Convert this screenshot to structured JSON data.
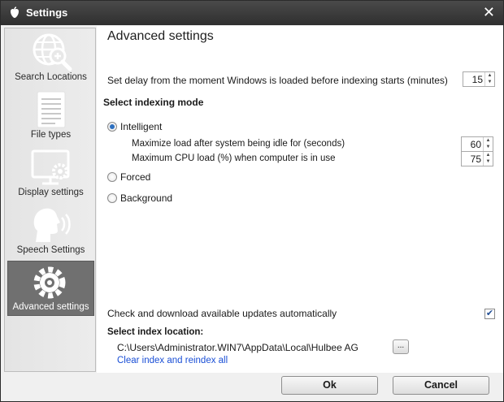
{
  "window": {
    "title": "Settings",
    "close_glyph": "✕"
  },
  "sidebar": {
    "items": [
      {
        "label": "Search Locations",
        "icon": "globe-search-icon"
      },
      {
        "label": "File types",
        "icon": "document-icon"
      },
      {
        "label": "Display settings",
        "icon": "display-gear-icon"
      },
      {
        "label": "Speech Settings",
        "icon": "speaking-head-icon"
      },
      {
        "label": "Advanced settings",
        "icon": "gear-icon",
        "selected": true
      }
    ]
  },
  "main": {
    "title": "Advanced settings",
    "delay_label": "Set delay from the moment Windows is loaded before indexing starts (minutes)",
    "delay_value": "15",
    "mode_heading": "Select indexing mode",
    "modes": {
      "intelligent": {
        "label": "Intelligent",
        "selected": true
      },
      "forced": {
        "label": "Forced",
        "selected": false
      },
      "background": {
        "label": "Background",
        "selected": false
      }
    },
    "idle_label": "Maximize load after system being idle for (seconds)",
    "idle_value": "60",
    "cpu_label": "Maximum CPU load (%) when computer is in use",
    "cpu_value": "75",
    "updates_label": "Check and download available updates automatically",
    "updates_checked": true,
    "index_location_heading": "Select index location:",
    "index_path": "C:\\Users\\Administrator.WIN7\\AppData\\Local\\Hulbee AG",
    "browse_label": "...",
    "clear_link": "Clear index and reindex all"
  },
  "footer": {
    "ok_label": "Ok",
    "cancel_label": "Cancel"
  },
  "colors": {
    "titlebar": "#353535",
    "sidebar_selected": "#707070",
    "link": "#1a4fd6"
  }
}
